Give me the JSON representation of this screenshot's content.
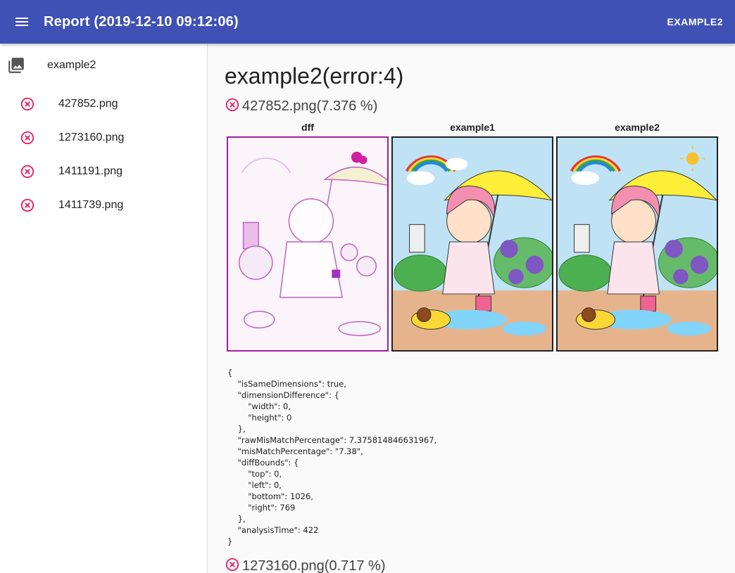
{
  "appbar": {
    "title": "Report (2019-12-10 09:12:06)",
    "right_label": "EXAMPLE2",
    "menu_icon": "menu-icon",
    "color": "#3f51b5"
  },
  "sidebar": {
    "group": {
      "label": "example2",
      "icon": "photo-library-icon"
    },
    "items": [
      {
        "label": "427852.png",
        "icon": "error-circle-icon"
      },
      {
        "label": "1273160.png",
        "icon": "error-circle-icon"
      },
      {
        "label": "1411191.png",
        "icon": "error-circle-icon"
      },
      {
        "label": "1411739.png",
        "icon": "error-circle-icon"
      }
    ],
    "error_color": "#e91e63"
  },
  "main": {
    "section_title": "example2(error:4)",
    "files": [
      {
        "name": "427852.png(7.376 %)",
        "images": [
          {
            "caption": "dff",
            "kind": "diff"
          },
          {
            "caption": "example1",
            "kind": "expected"
          },
          {
            "caption": "example2",
            "kind": "actual"
          }
        ],
        "json": "{\n    \"isSameDimensions\": true,\n    \"dimensionDifference\": {\n        \"width\": 0,\n        \"height\": 0\n    },\n    \"rawMisMatchPercentage\": 7.375814846631967,\n    \"misMatchPercentage\": \"7.38\",\n    \"diffBounds\": {\n        \"top\": 0,\n        \"left\": 0,\n        \"bottom\": 1026,\n        \"right\": 769\n    },\n    \"analysisTime\": 422\n}"
      },
      {
        "name": "1273160.png(0.717 %)"
      }
    ]
  }
}
